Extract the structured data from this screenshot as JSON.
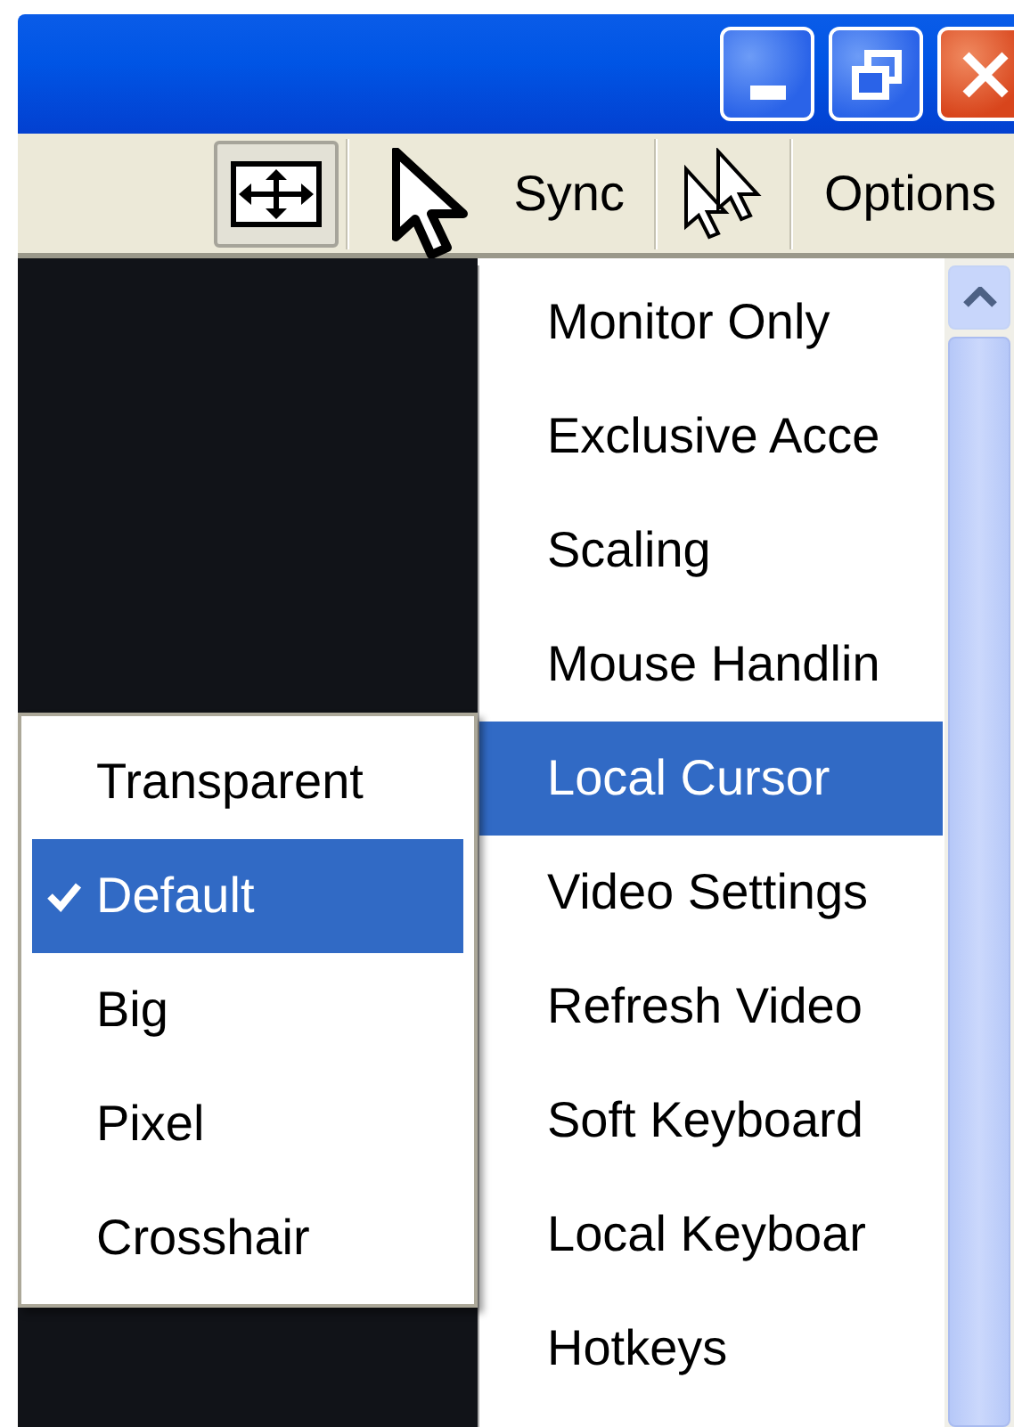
{
  "toolbar": {
    "sync_label": "Sync",
    "options_label": "Options"
  },
  "menu": {
    "items": [
      {
        "label": "Monitor Only",
        "selected": false
      },
      {
        "label": "Exclusive Acce",
        "selected": false
      },
      {
        "label": "Scaling",
        "selected": false
      },
      {
        "label": "Mouse Handlin",
        "selected": false
      },
      {
        "label": "Local Cursor",
        "selected": true
      },
      {
        "label": "Video Settings",
        "selected": false
      },
      {
        "label": "Refresh Video",
        "selected": false
      },
      {
        "label": "Soft Keyboard",
        "selected": false
      },
      {
        "label": "Local Keyboar",
        "selected": false
      },
      {
        "label": "Hotkeys",
        "selected": false
      }
    ]
  },
  "submenu": {
    "items": [
      {
        "label": "Transparent",
        "selected": false,
        "checked": false
      },
      {
        "label": "Default",
        "selected": true,
        "checked": true
      },
      {
        "label": "Big",
        "selected": false,
        "checked": false
      },
      {
        "label": "Pixel",
        "selected": false,
        "checked": false
      },
      {
        "label": "Crosshair",
        "selected": false,
        "checked": false
      }
    ]
  }
}
